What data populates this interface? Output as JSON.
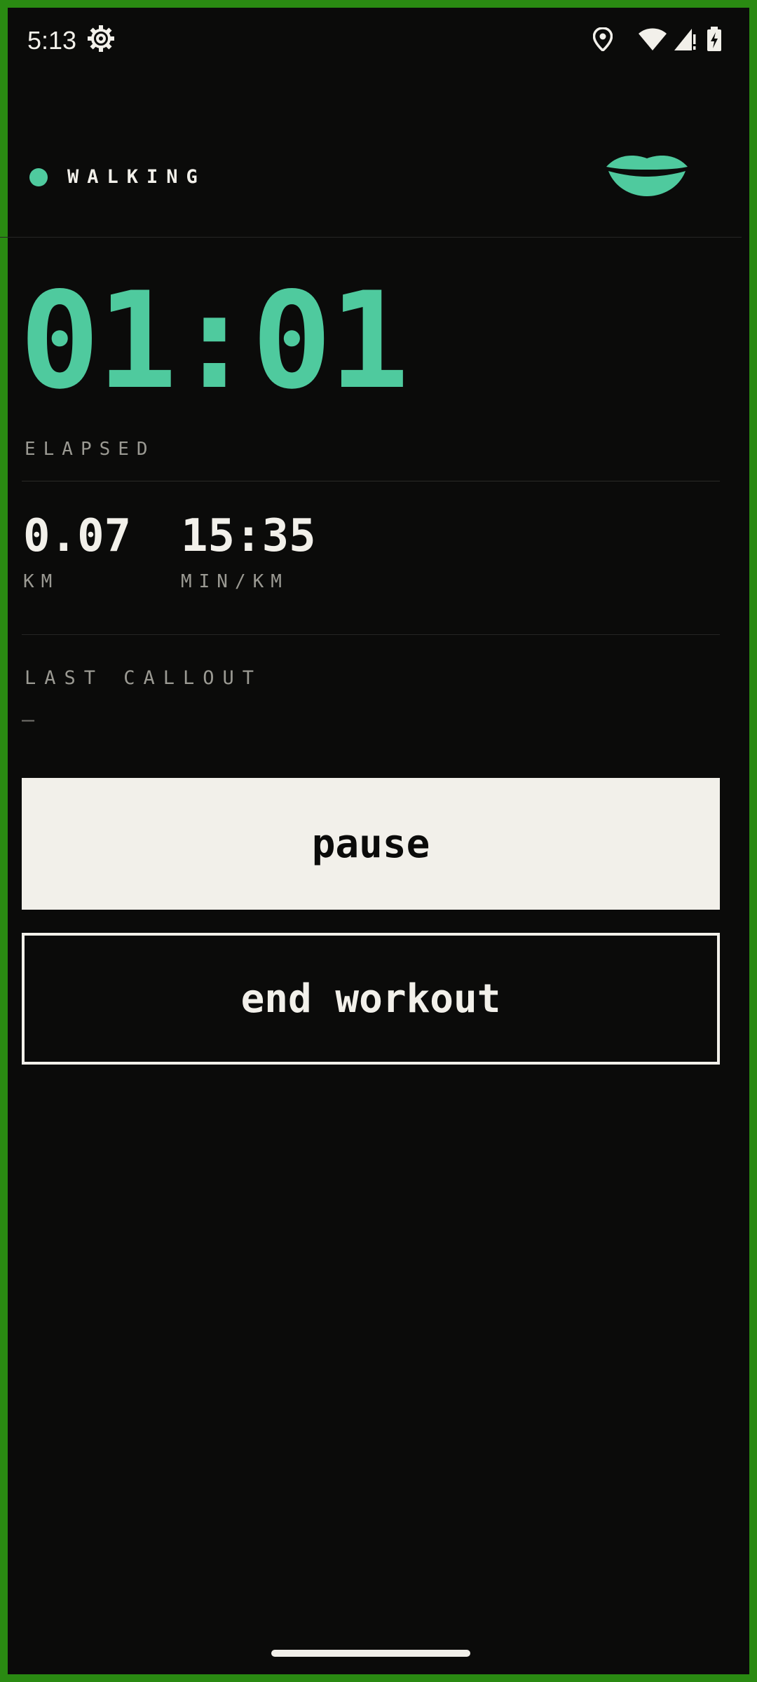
{
  "status_bar": {
    "time": "5:13",
    "icons": [
      "settings-gear-icon",
      "location-pin-icon",
      "wifi-icon",
      "cell-signal-icon",
      "battery-charging-icon"
    ]
  },
  "header": {
    "mode": "WALKING",
    "logo": "lips-logo"
  },
  "elapsed": {
    "value": "01:01",
    "label": "ELAPSED"
  },
  "stats": [
    {
      "value": "0.07",
      "unit": "KM"
    },
    {
      "value": "15:35",
      "unit": "MIN/KM"
    }
  ],
  "callout": {
    "label": "LAST CALLOUT",
    "value": "—"
  },
  "actions": {
    "pause_label": "pause",
    "end_label": "end workout"
  },
  "colors": {
    "accent": "#4fca9e",
    "background": "#0b0b0a",
    "foreground": "#f2f0ea",
    "muted": "#9b9a93",
    "frame": "#2a8a12"
  }
}
